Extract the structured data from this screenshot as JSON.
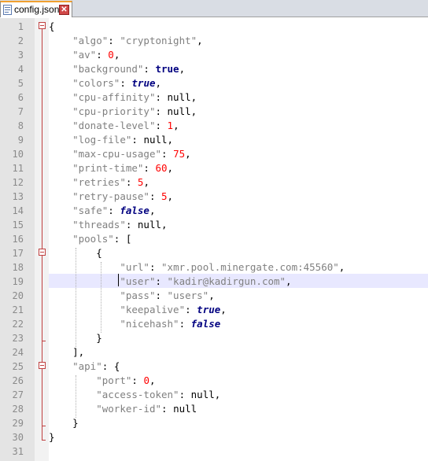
{
  "tab": {
    "label": "config.json",
    "close": "✕"
  },
  "lines": [
    {
      "n": "1"
    },
    {
      "n": "2"
    },
    {
      "n": "3"
    },
    {
      "n": "4"
    },
    {
      "n": "5"
    },
    {
      "n": "6"
    },
    {
      "n": "7"
    },
    {
      "n": "8"
    },
    {
      "n": "9"
    },
    {
      "n": "10"
    },
    {
      "n": "11"
    },
    {
      "n": "12"
    },
    {
      "n": "13"
    },
    {
      "n": "14"
    },
    {
      "n": "15"
    },
    {
      "n": "16"
    },
    {
      "n": "17"
    },
    {
      "n": "18"
    },
    {
      "n": "19"
    },
    {
      "n": "20"
    },
    {
      "n": "21"
    },
    {
      "n": "22"
    },
    {
      "n": "23"
    },
    {
      "n": "24"
    },
    {
      "n": "25"
    },
    {
      "n": "26"
    },
    {
      "n": "27"
    },
    {
      "n": "28"
    },
    {
      "n": "29"
    },
    {
      "n": "30"
    },
    {
      "n": "31"
    }
  ],
  "code": {
    "l1": "{",
    "l2_k": "\"algo\"",
    "l2_v": "\"cryptonight\"",
    "l3_k": "\"av\"",
    "l3_v": "0",
    "l4_k": "\"background\"",
    "l4_v": "true",
    "l5_k": "\"colors\"",
    "l5_v": "true",
    "l6_k": "\"cpu-affinity\"",
    "l6_v": "null",
    "l7_k": "\"cpu-priority\"",
    "l7_v": "null",
    "l8_k": "\"donate-level\"",
    "l8_v": "1",
    "l9_k": "\"log-file\"",
    "l9_v": "null",
    "l10_k": "\"max-cpu-usage\"",
    "l10_v": "75",
    "l11_k": "\"print-time\"",
    "l11_v": "60",
    "l12_k": "\"retries\"",
    "l12_v": "5",
    "l13_k": "\"retry-pause\"",
    "l13_v": "5",
    "l14_k": "\"safe\"",
    "l14_v": "false",
    "l15_k": "\"threads\"",
    "l15_v": "null",
    "l16_k": "\"pools\"",
    "l16_v": "[",
    "l17": "{",
    "l18_k": "\"url\"",
    "l18_v": "\"xmr.pool.minergate.com:45560\"",
    "l19_k": "\"user\"",
    "l19_v": "\"kadir@kadirgun.com\"",
    "l20_k": "\"pass\"",
    "l20_v": "\"users\"",
    "l21_k": "\"keepalive\"",
    "l21_v": "true",
    "l22_k": "\"nicehash\"",
    "l22_v": "false",
    "l23": "}",
    "l24": "],",
    "l25_k": "\"api\"",
    "l25_v": "{",
    "l26_k": "\"port\"",
    "l26_v": "0",
    "l27_k": "\"access-token\"",
    "l27_v": "null",
    "l28_k": "\"worker-id\"",
    "l28_v": "null",
    "l29": "}",
    "l30": "}",
    "l31": ""
  },
  "colors": {
    "key": "#808080",
    "number": "#ff0000",
    "keyword": "#000080",
    "fold": "#c04040",
    "highlight": "#e8e8ff"
  }
}
